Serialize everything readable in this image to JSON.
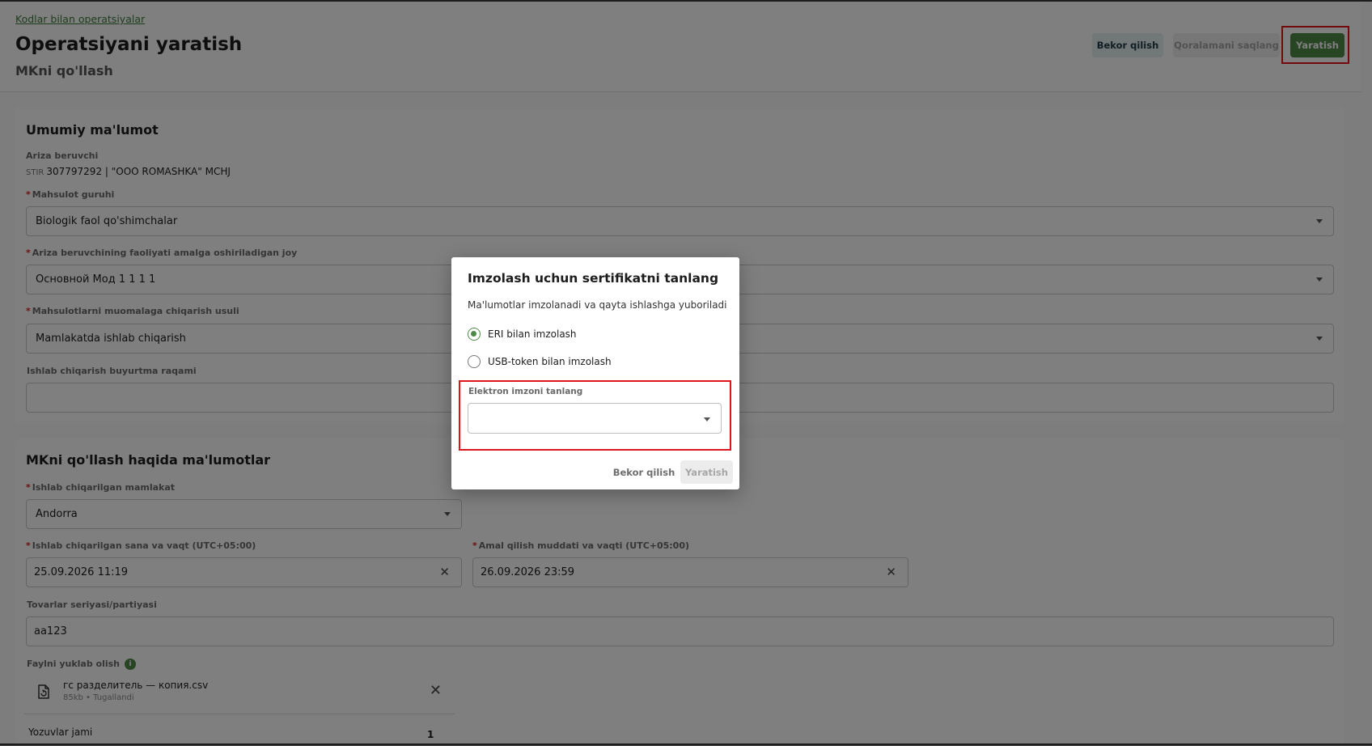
{
  "header": {
    "breadcrumb": "Kodlar bilan operatsiyalar",
    "title": "Operatsiyani yaratish",
    "subtitle": "MKni qo'llash",
    "buttons": {
      "cancel": "Bekor qilish",
      "save_draft": "Qoralamani saqlang",
      "create": "Yaratish"
    }
  },
  "general_info": {
    "section_title": "Umumiy ma'lumot",
    "applicant_label": "Ariza beruvchi",
    "applicant_stir_prefix": "STIR",
    "applicant_value": "307797292 | \"OOO ROMASHKA\" MCHJ",
    "product_group": {
      "label": "Mahsulot guruhi",
      "value": "Biologik faol qo'shimchalar"
    },
    "activity_place": {
      "label": "Ariza beruvchining faoliyati amalga oshiriladigan joy",
      "value": "Основной Мод 1 1 1 1"
    },
    "circulation_method": {
      "label": "Mahsulotlarni muomalaga chiqarish usuli",
      "value": "Mamlakatda ishlab chiqarish"
    },
    "production_order": {
      "label": "Ishlab chiqarish buyurtma raqami",
      "value": ""
    }
  },
  "mk_info": {
    "section_title": "MKni qo'llash haqida ma'lumotlar",
    "country": {
      "label": "Ishlab chiqarilgan mamlakat",
      "value": "Andorra"
    },
    "production_date": {
      "label": "Ishlab chiqarilgan sana va vaqt (UTC+05:00)",
      "value": "25.09.2026 11:19"
    },
    "expiry_date": {
      "label": "Amal qilish muddati va vaqti (UTC+05:00)",
      "value": "26.09.2026 23:59"
    },
    "series": {
      "label": "Tovarlar seriyasi/partiyasi",
      "value": "aa123"
    },
    "file_upload_label": "Faylni yuklab olish",
    "file_info_icon": "i",
    "file": {
      "name": "гс разделитель — копия.csv",
      "meta": "85kb • Tugallandi"
    },
    "total_label": "Yozuvlar jami",
    "total_value": "1"
  },
  "modal": {
    "title": "Imzolash uchun sertifikatni tanlang",
    "description": "Ma'lumotlar imzolanadi va qayta ishlashga yuboriladi",
    "options": [
      {
        "label": "ERI bilan imzolash",
        "selected": true
      },
      {
        "label": "USB-token bilan imzolash",
        "selected": false
      }
    ],
    "signature_label": "Elektron imzoni tanlang",
    "signature_value": "",
    "cancel": "Bekor qilish",
    "create": "Yaratish"
  },
  "colors": {
    "accent": "#4e8a47",
    "highlight": "#e0141c",
    "required": "#d6261e"
  },
  "icons": [
    "chevron-down-icon",
    "close-icon",
    "file-icon",
    "info-icon",
    "radio-checked-icon",
    "radio-unchecked-icon"
  ]
}
